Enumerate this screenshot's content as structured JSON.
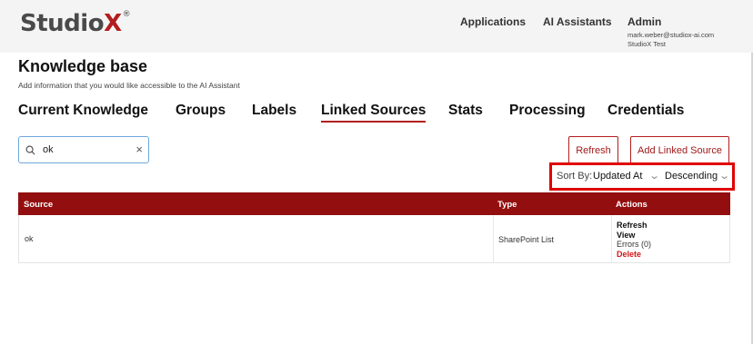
{
  "header": {
    "logo_main": "Studio",
    "logo_x": "X",
    "logo_reg": "®",
    "nav": {
      "applications": "Applications",
      "ai_assistants": "AI Assistants"
    },
    "user": {
      "name": "Admin",
      "email": "mark.weber@studiox-ai.com",
      "org": "StudioX Test"
    }
  },
  "page": {
    "title": "Knowledge base",
    "subtitle": "Add information that you would like accessible to the AI Assistant"
  },
  "tabs": [
    {
      "label": "Current Knowledge",
      "active": false
    },
    {
      "label": "Groups",
      "active": false
    },
    {
      "label": "Labels",
      "active": false
    },
    {
      "label": "Linked Sources",
      "active": true
    },
    {
      "label": "Stats",
      "active": false
    },
    {
      "label": "Processing",
      "active": false
    },
    {
      "label": "Credentials",
      "active": false
    }
  ],
  "search": {
    "value": "ok",
    "clear_glyph": "×"
  },
  "buttons": {
    "refresh": "Refresh",
    "add_linked_source": "Add Linked Source"
  },
  "sort": {
    "label": "Sort By:",
    "field": "Updated At",
    "order": "Descending"
  },
  "table": {
    "columns": [
      "Source",
      "Type",
      "Actions"
    ],
    "rows": [
      {
        "source": "ok",
        "type": "SharePoint List",
        "actions": [
          "Refresh",
          "View",
          "Errors (0)",
          "Delete"
        ]
      }
    ]
  },
  "colors": {
    "accent": "#b21e1e",
    "table_header": "#930f0f",
    "highlight_box": "#e00000",
    "search_border": "#6fa8dc"
  }
}
